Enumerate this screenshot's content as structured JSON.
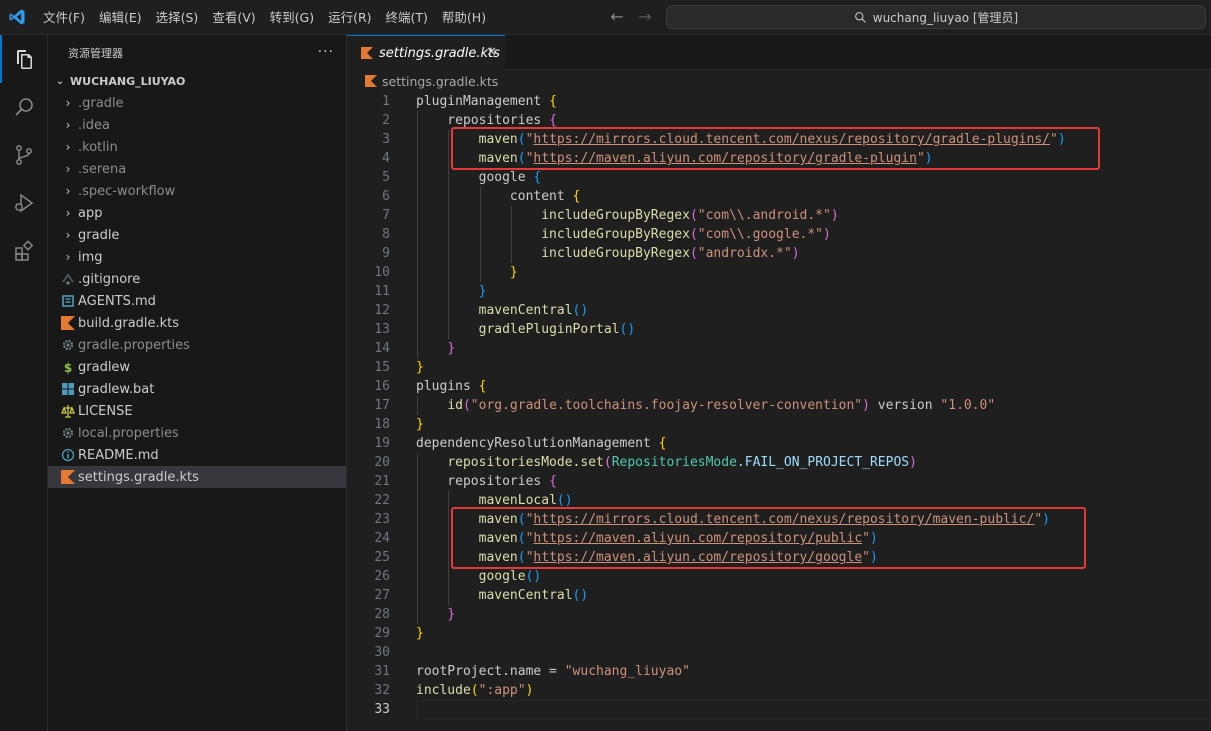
{
  "menubar": {
    "items": [
      "文件(F)",
      "编辑(E)",
      "选择(S)",
      "查看(V)",
      "转到(G)",
      "运行(R)",
      "终端(T)",
      "帮助(H)"
    ]
  },
  "command_center": {
    "text": "wuchang_liuyao [管理员]"
  },
  "activity_bar": {
    "icons": [
      "explorer-icon",
      "search-icon",
      "source-control-icon",
      "run-debug-icon",
      "extensions-icon"
    ]
  },
  "sidebar": {
    "title": "资源管理器",
    "more": "···",
    "folder": "WUCHANG_LIUYAO",
    "items": [
      {
        "label": ".gradle",
        "type": "folder",
        "dim": true
      },
      {
        "label": ".idea",
        "type": "folder",
        "dim": true
      },
      {
        "label": ".kotlin",
        "type": "folder",
        "dim": true
      },
      {
        "label": ".serena",
        "type": "folder",
        "dim": true
      },
      {
        "label": ".spec-workflow",
        "type": "folder",
        "dim": true
      },
      {
        "label": "app",
        "type": "folder",
        "dim": false
      },
      {
        "label": "gradle",
        "type": "folder",
        "dim": false
      },
      {
        "label": "img",
        "type": "folder",
        "dim": false
      },
      {
        "label": ".gitignore",
        "type": "file",
        "icon": "git-icon",
        "dim": false
      },
      {
        "label": "AGENTS.md",
        "type": "file",
        "icon": "markdown-icon",
        "dim": false
      },
      {
        "label": "build.gradle.kts",
        "type": "file",
        "icon": "kotlin-icon",
        "dim": false
      },
      {
        "label": "gradle.properties",
        "type": "file",
        "icon": "gear-icon",
        "dim": true
      },
      {
        "label": "gradlew",
        "type": "file",
        "icon": "shell-icon",
        "dim": false
      },
      {
        "label": "gradlew.bat",
        "type": "file",
        "icon": "windows-icon",
        "dim": false
      },
      {
        "label": "LICENSE",
        "type": "file",
        "icon": "license-icon",
        "dim": false
      },
      {
        "label": "local.properties",
        "type": "file",
        "icon": "gear-icon",
        "dim": true
      },
      {
        "label": "README.md",
        "type": "file",
        "icon": "info-icon",
        "dim": false
      },
      {
        "label": "settings.gradle.kts",
        "type": "file",
        "icon": "kotlin-icon",
        "dim": false,
        "selected": true
      }
    ]
  },
  "editor": {
    "tab_label": "settings.gradle.kts",
    "tab_close": "✕",
    "breadcrumb": "settings.gradle.kts",
    "current_line": 33,
    "lines": [
      [
        [
          "pluginManagement ",
          "id"
        ],
        [
          "{",
          "b1"
        ]
      ],
      [
        [
          "    repositories ",
          "id"
        ],
        [
          "{",
          "b2"
        ]
      ],
      [
        [
          "        maven",
          "id"
        ],
        [
          "(",
          "b3"
        ],
        [
          "\"",
          "str"
        ],
        [
          "https://mirrors.cloud.tencent.com/nexus/repository/gradle-plugins/",
          "link"
        ],
        [
          "\"",
          "str"
        ],
        [
          ")",
          "b3"
        ]
      ],
      [
        [
          "        maven",
          "id"
        ],
        [
          "(",
          "b3"
        ],
        [
          "\"",
          "str"
        ],
        [
          "https://maven.aliyun.com/repository/gradle-plugin",
          "link"
        ],
        [
          "\"",
          "str"
        ],
        [
          ")",
          "b3"
        ]
      ],
      [
        [
          "        google ",
          "id"
        ],
        [
          "{",
          "b3"
        ]
      ],
      [
        [
          "            content ",
          "id"
        ],
        [
          "{",
          "b1"
        ]
      ],
      [
        [
          "                includeGroupByRegex",
          "id"
        ],
        [
          "(",
          "b2"
        ],
        [
          "\"com\\\\.android.*\"",
          "str"
        ],
        [
          ")",
          "b2"
        ]
      ],
      [
        [
          "                includeGroupByRegex",
          "id"
        ],
        [
          "(",
          "b2"
        ],
        [
          "\"com\\\\.google.*\"",
          "str"
        ],
        [
          ")",
          "b2"
        ]
      ],
      [
        [
          "                includeGroupByRegex",
          "id"
        ],
        [
          "(",
          "b2"
        ],
        [
          "\"androidx.*\"",
          "str"
        ],
        [
          ")",
          "b2"
        ]
      ],
      [
        [
          "            ",
          "id"
        ],
        [
          "}",
          "b1"
        ]
      ],
      [
        [
          "        ",
          "id"
        ],
        [
          "}",
          "b3"
        ]
      ],
      [
        [
          "        mavenCentral",
          "id"
        ],
        [
          "()",
          "b3"
        ]
      ],
      [
        [
          "        gradlePluginPortal",
          "id"
        ],
        [
          "()",
          "b3"
        ]
      ],
      [
        [
          "    ",
          "id"
        ],
        [
          "}",
          "b2"
        ]
      ],
      [
        [
          "}",
          "b1"
        ]
      ],
      [
        [
          "plugins ",
          "id"
        ],
        [
          "{",
          "b1"
        ]
      ],
      [
        [
          "    id",
          "id"
        ],
        [
          "(",
          "b2"
        ],
        [
          "\"org.gradle.toolchains.foojay-resolver-convention\"",
          "str"
        ],
        [
          ")",
          "b2"
        ],
        [
          " version ",
          "id"
        ],
        [
          "\"1.0.0\"",
          "str"
        ]
      ],
      [
        [
          "}",
          "b1"
        ]
      ],
      [
        [
          "dependencyResolutionManagement ",
          "id"
        ],
        [
          "{",
          "b1"
        ]
      ],
      [
        [
          "    repositoriesMode.set",
          "id"
        ],
        [
          "(",
          "b2"
        ],
        [
          "RepositoriesMode",
          "enum"
        ],
        [
          ".FAIL_ON_PROJECT_REPOS",
          "member"
        ],
        [
          ")",
          "b2"
        ]
      ],
      [
        [
          "    repositories ",
          "id"
        ],
        [
          "{",
          "b2"
        ]
      ],
      [
        [
          "        mavenLocal",
          "id"
        ],
        [
          "()",
          "b3"
        ]
      ],
      [
        [
          "        maven",
          "id"
        ],
        [
          "(",
          "b3"
        ],
        [
          "\"",
          "str"
        ],
        [
          "https://mirrors.cloud.tencent.com/nexus/repository/maven-public/",
          "link"
        ],
        [
          "\"",
          "str"
        ],
        [
          ")",
          "b3"
        ]
      ],
      [
        [
          "        maven",
          "id"
        ],
        [
          "(",
          "b3"
        ],
        [
          "\"",
          "str"
        ],
        [
          "https://maven.aliyun.com/repository/public",
          "link"
        ],
        [
          "\"",
          "str"
        ],
        [
          ")",
          "b3"
        ]
      ],
      [
        [
          "        maven",
          "id"
        ],
        [
          "(",
          "b3"
        ],
        [
          "\"",
          "str"
        ],
        [
          "https://maven.aliyun.com/repository/google",
          "link"
        ],
        [
          "\"",
          "str"
        ],
        [
          ")",
          "b3"
        ]
      ],
      [
        [
          "        google",
          "id"
        ],
        [
          "()",
          "b3"
        ]
      ],
      [
        [
          "        mavenCentral",
          "id"
        ],
        [
          "()",
          "b3"
        ]
      ],
      [
        [
          "    ",
          "id"
        ],
        [
          "}",
          "b2"
        ]
      ],
      [
        [
          "}",
          "b1"
        ]
      ],
      [],
      [
        [
          "rootProject.name = ",
          "id"
        ],
        [
          "\"wuchang_liuyao\"",
          "str"
        ]
      ],
      [
        [
          "include",
          "id"
        ],
        [
          "(",
          "b1"
        ],
        [
          "\":app\"",
          "str"
        ],
        [
          ")",
          "b1"
        ]
      ],
      []
    ]
  },
  "colors": {
    "highlight_border": "#e53935",
    "accent": "#0078d4"
  }
}
